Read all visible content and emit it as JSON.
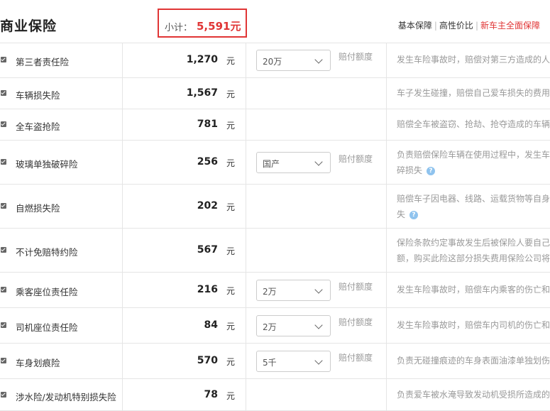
{
  "header": {
    "title": "商业保险",
    "subtotal_label": "小计：",
    "subtotal_value": "5,591元",
    "tabs": [
      "基本保障",
      "高性价比",
      "新车主全面保障"
    ],
    "tab_separator": "|",
    "active_tab_color": "#e03535"
  },
  "unit": "元",
  "coverage_note": "赔付额度",
  "rows": [
    {
      "name": "第三者责任险",
      "price": "1,270",
      "select": "20万",
      "desc1": "发生车险事故时，赔偿对第三方造成的人"
    },
    {
      "name": "车辆损失险",
      "price": "1,567",
      "desc1": "车子发生碰撞，赔偿自己爱车损失的费用"
    },
    {
      "name": "全车盗抢险",
      "price": "781",
      "desc1": "赔偿全车被盗窃、抢劫、抢夺造成的车辆"
    },
    {
      "name": "玻璃单独破碎险",
      "price": "256",
      "select": "国产",
      "desc1": "负责赔偿保险车辆在使用过程中，发生车",
      "desc2": "碎损失"
    },
    {
      "name": "自燃损失险",
      "price": "202",
      "desc1": "赔偿车子因电器、线路、运载货物等自身",
      "desc2": "失"
    },
    {
      "name": "不计免赔特约险",
      "price": "567",
      "desc1": "保险条款约定事故发生后被保险人要自己",
      "desc2": "额，购买此险这部分损失费用保险公司将"
    },
    {
      "name": "乘客座位责任险",
      "price": "216",
      "select": "2万",
      "desc1": "发生车险事故时，赔偿车内乘客的伤亡和"
    },
    {
      "name": "司机座位责任险",
      "price": "84",
      "select": "2万",
      "desc1": "发生车险事故时，赔偿车内司机的伤亡和"
    },
    {
      "name": "车身划痕险",
      "price": "570",
      "select": "5千",
      "desc1": "负责无碰撞痕迹的车身表面油漆单独划伤"
    },
    {
      "name": "涉水险/发动机特别损失险",
      "price": "78",
      "desc1": "负责爱车被水淹导致发动机受损所造成的"
    }
  ]
}
